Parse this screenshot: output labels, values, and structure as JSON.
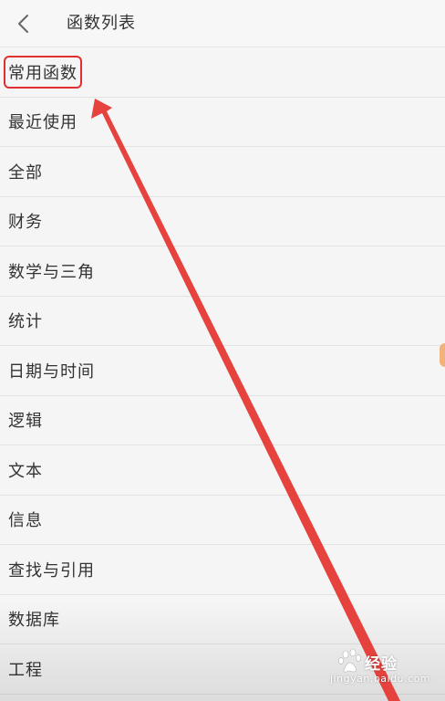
{
  "header": {
    "title": "函数列表",
    "back_icon": "chevron-left-icon"
  },
  "categories": [
    "常用函数",
    "最近使用",
    "全部",
    "财务",
    "数学与三角",
    "统计",
    "日期与时间",
    "逻辑",
    "文本",
    "信息",
    "查找与引用",
    "数据库",
    "工程"
  ],
  "highlighted_index": 0,
  "annotation": {
    "highlight_color": "#e02f2f",
    "arrow_color": "#e53935"
  },
  "watermark": {
    "brand": "Baidu经验",
    "title": "经验",
    "url": "jingyan.baidu.com"
  }
}
